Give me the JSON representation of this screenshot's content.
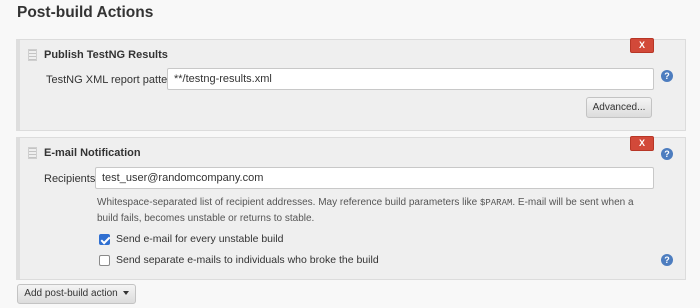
{
  "section": {
    "title": "Post-build Actions"
  },
  "testng": {
    "title": "Publish TestNG Results",
    "delete_label": "X",
    "pattern_label": "TestNG XML report pattern",
    "pattern_value": "**/testng-results.xml",
    "advanced_label": "Advanced..."
  },
  "email": {
    "title": "E-mail Notification",
    "delete_label": "X",
    "recipients_label": "Recipients",
    "recipients_value": "test_user@randomcompany.com",
    "description_part1": "Whitespace-separated list of recipient addresses. May reference build parameters like ",
    "description_code": "$PARAM",
    "description_part2": ". E-mail will be sent when a build fails, becomes unstable or returns to stable.",
    "checkbox_unstable": {
      "label": "Send e-mail for every unstable build",
      "checked": true
    },
    "checkbox_separate": {
      "label": "Send separate e-mails to individuals who broke the build",
      "checked": false
    }
  },
  "help_glyph": "?",
  "add_action": {
    "label": "Add post-build action"
  },
  "colors": {
    "delete_button": "#d24939",
    "help_icon": "#4d7dbf",
    "checkbox_checked": "#2f6fd1"
  }
}
